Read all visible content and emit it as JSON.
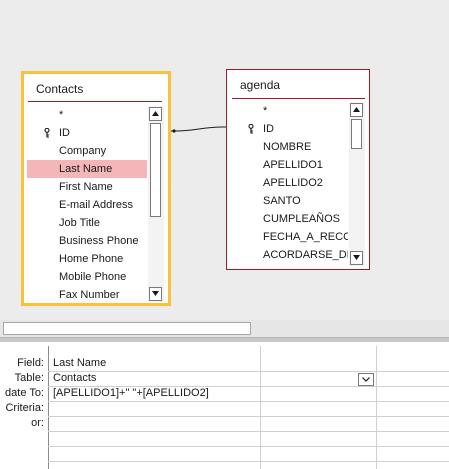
{
  "tables": [
    {
      "name": "Contacts",
      "fields": [
        "*",
        "ID",
        "Company",
        "Last Name",
        "First Name",
        "E-mail Address",
        "Job Title",
        "Business Phone",
        "Home Phone",
        "Mobile Phone",
        "Fax Number"
      ],
      "primary_key": "ID",
      "selected_field": "Last Name"
    },
    {
      "name": "agenda",
      "fields": [
        "*",
        "ID",
        "NOMBRE",
        "APELLIDO1",
        "APELLIDO2",
        "SANTO",
        "CUMPLEAÑOS",
        "FECHA_A_RECOR",
        "ACORDARSE_DE"
      ],
      "primary_key": "ID"
    }
  ],
  "grid": {
    "row_labels": {
      "field": "Field:",
      "table": "Table:",
      "update_to": "date To:",
      "criteria": "Criteria:",
      "or": "or:"
    },
    "columns": [
      {
        "field": "Last Name",
        "table": "Contacts",
        "update_to": "[APELLIDO1]+\" \"+[APELLIDO2]",
        "criteria": "",
        "or": ""
      }
    ]
  },
  "icons": {
    "primary_key": "key-icon",
    "scroll_up": "triangle-up-icon",
    "scroll_down": "triangle-down-icon",
    "dropdown": "chevron-down-icon"
  },
  "colors": {
    "selected_table_border": "#f7c23c",
    "table_border": "#9b1d2c",
    "selected_field_bg": "#f4b6b8",
    "design_background": "#ececec"
  }
}
